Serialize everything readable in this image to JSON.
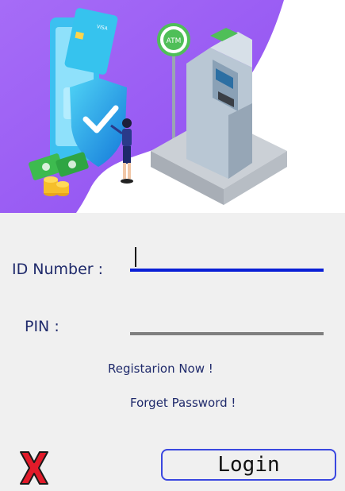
{
  "hero": {
    "card_brand": "VISA",
    "atm_sign": "ATM"
  },
  "form": {
    "id_label": "ID Number :",
    "id_value": "",
    "pin_label": "PIN :",
    "pin_value": ""
  },
  "links": {
    "register": "Registarion Now !",
    "forget_password": "Forget Password !"
  },
  "actions": {
    "login_label": "Login",
    "exit_icon": "red-x-icon"
  },
  "colors": {
    "accent_blue": "#0a1fd6",
    "hero_purple": "#9a5bf5",
    "exit_red": "#e21b2a"
  }
}
